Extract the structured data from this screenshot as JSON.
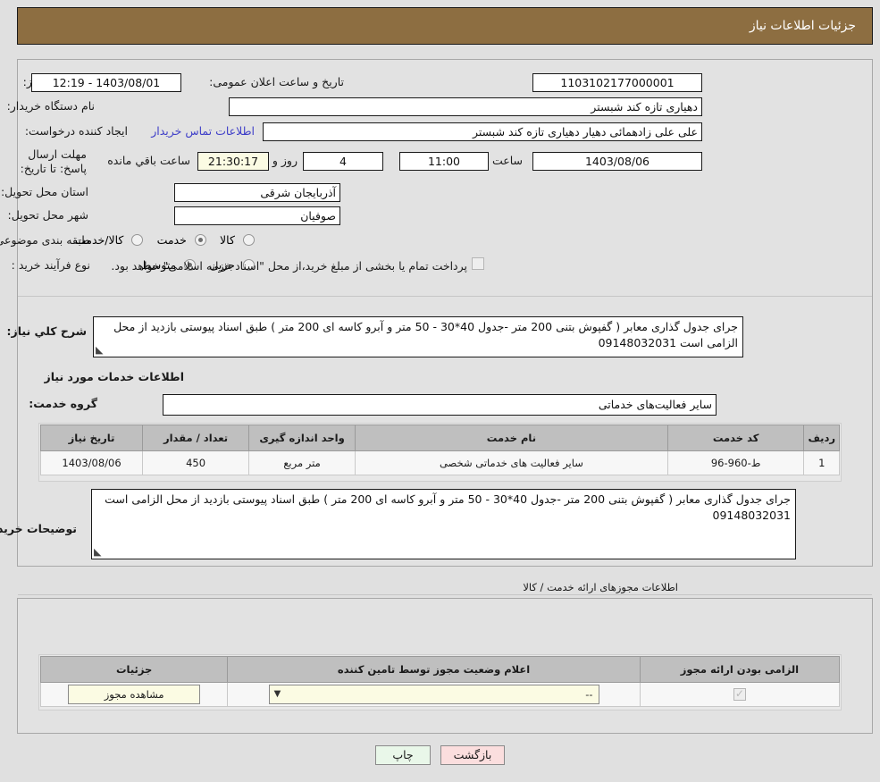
{
  "header": {
    "title": "جزئیات اطلاعات نیاز"
  },
  "form": {
    "need_number_label": "شماره نیاز:",
    "need_number_value": "1103102177000001",
    "announce_datetime_label": "تاریخ و ساعت اعلان عمومی:",
    "announce_datetime_value": "1403/08/01 - 12:19",
    "buyer_org_label": "نام دستگاه خریدار:",
    "buyer_org_value": "دهیاری تازه کند شبستر",
    "creator_label": "ایجاد کننده درخواست:",
    "creator_value": "علی علی زادهمائی دهیار دهیاری تازه کند شبستر",
    "contact_link": "اطلاعات تماس خریدار",
    "deadline_label": "مهلت ارسال پاسخ: تا تاریخ:",
    "deadline_date": "1403/08/06",
    "hour_label": "ساعت",
    "hour_value": "11:00",
    "days_value": "4",
    "days_label": "روز و",
    "countdown_value": "21:30:17",
    "remaining_label": "ساعت باقي مانده",
    "province_label": "استان محل تحویل:",
    "province_value": "آذربایجان شرقی",
    "city_label": "شهر محل تحویل:",
    "city_value": "صوفیان",
    "category_label": "طبقه بندی موضوعی:",
    "category_options": [
      {
        "label": "کالا",
        "selected": false
      },
      {
        "label": "خدمت",
        "selected": true
      },
      {
        "label": "کالا/خدمت",
        "selected": false
      }
    ],
    "process_label": "نوع فرآیند خرید :",
    "process_options": [
      {
        "label": "جزیی",
        "selected": false
      },
      {
        "label": "متوسط",
        "selected": true
      }
    ],
    "payment_checkbox_checked": false,
    "payment_note": "پرداخت تمام یا بخشی از مبلغ خرید،از محل \"اسناد خزانه اسلامی\" خواهد بود."
  },
  "summary": {
    "label": "شرح کلي نیاز:",
    "text": "جرای جدول گذاری معابر ( گفپوش بتنی 200 متر -جدول 40*30 - 50 متر و آبرو کاسه ای 200 متر ) طبق اسناد پیوستی بازدید از محل الزامی است 09148032031"
  },
  "services_section": {
    "title": "اطلاعات خدمات مورد نیاز",
    "group_label": "گروه خدمت:",
    "group_value": "سایر فعالیت‌های خدماتی",
    "table": {
      "columns": [
        "ردیف",
        "کد خدمت",
        "نام خدمت",
        "واحد اندازه گیری",
        "تعداد / مقدار",
        "تاریخ نیاز"
      ],
      "rows": [
        [
          "1",
          "ط-960-96",
          "سایر فعالیت های خدماتی شخصی",
          "متر مربع",
          "450",
          "1403/08/06"
        ]
      ]
    }
  },
  "buyer_notes": {
    "label": "توضیحات خریدار:",
    "text": "جرای جدول گذاری معابر ( گفپوش بتنی 200 متر -جدول 40*30 - 50 متر و آبرو کاسه ای 200 متر ) طبق اسناد پیوستی بازدید از محل الزامی است 09148032031"
  },
  "licenses": {
    "caption": "اطلاعات مجوزهای ارائه خدمت / کالا",
    "table": {
      "columns": [
        "الزامی بودن ارائه مجوز",
        "اعلام وضعیت مجوز توسط تامین کننده",
        "جزئیات"
      ],
      "rows": [
        {
          "required": true,
          "status_value": "--",
          "details_button": "مشاهده مجوز"
        }
      ]
    }
  },
  "footer": {
    "print_label": "چاپ",
    "back_label": "بازگشت"
  },
  "colors": {
    "header_bar": "#8d6e41",
    "page_bg": "#e0e0e0",
    "panel_bg": "#e2e2e2",
    "link": "#3e3ec8",
    "table_header": "#bfbfbf",
    "print_btn": "#e9f7e9",
    "back_btn": "#fbdede",
    "field_yellow": "#fbfbe3"
  }
}
